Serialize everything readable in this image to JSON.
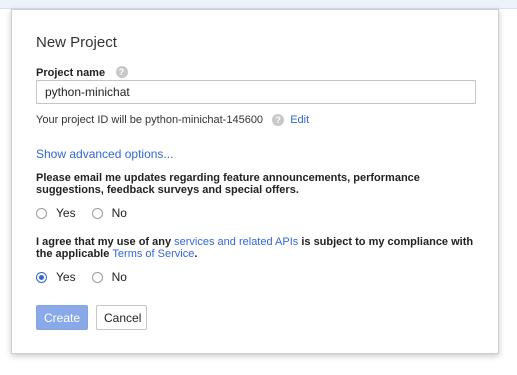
{
  "dialog": {
    "title": "New Project",
    "project_name": {
      "label": "Project name",
      "value": "python-minichat"
    },
    "project_id": {
      "text": "Your project ID will be python-minichat-145600",
      "edit_label": "Edit"
    },
    "advanced_link": "Show advanced options...",
    "email_updates": {
      "question": "Please email me updates regarding feature announcements, performance suggestions, feedback surveys and special offers.",
      "options": [
        "Yes",
        "No"
      ],
      "selected": null
    },
    "terms": {
      "text_before": "I agree that my use of any ",
      "link1": "services and related APIs",
      "text_middle": " is subject to my compliance with the applicable ",
      "link2": "Terms of Service",
      "text_after": ".",
      "options": [
        "Yes",
        "No"
      ],
      "selected": "Yes"
    },
    "buttons": {
      "create": "Create",
      "cancel": "Cancel"
    }
  },
  "icons": {
    "help": "help-icon"
  },
  "colors": {
    "link": "#3367d6",
    "primary_button_disabled": "#8aa9e8",
    "radio_selected": "#3367d6"
  }
}
